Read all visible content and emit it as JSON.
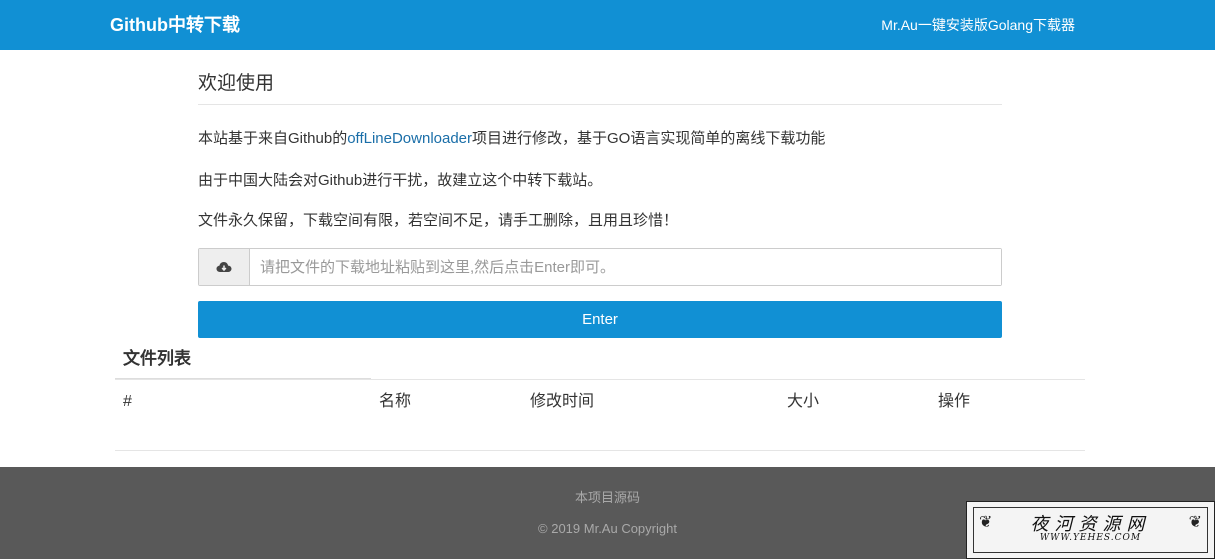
{
  "navbar": {
    "brand": "Github中转下载",
    "link": "Mr.Au一键安装版Golang下载器",
    "color": "#1190d4"
  },
  "main": {
    "welcome_title": "欢迎使用",
    "intro": {
      "line1_prefix": "本站基于来自Github的",
      "line1_link": "offLineDownloader",
      "line1_suffix": "项目进行修改，基于GO语言实现简单的离线下载功能",
      "line2": "由于中国大陆会对Github进行干扰，故建立这个中转下载站。",
      "line3": "文件永久保留，下载空间有限，若空间不足，请手工删除，且用且珍惜！"
    },
    "url_input": {
      "icon": "cloud-download-icon",
      "value": "",
      "placeholder": "请把文件的下载地址粘贴到这里,然后点击Enter即可。"
    },
    "enter_label": "Enter"
  },
  "files": {
    "title": "文件列表",
    "columns": [
      "#",
      "名称",
      "修改时间",
      "大小",
      "操作"
    ],
    "rows": []
  },
  "footer": {
    "source_link": "本项目源码",
    "copyright": "© 2019 Mr.Au Copyright"
  },
  "watermark": {
    "cn": "夜河资源网",
    "en": "WWW.YEHES.COM"
  }
}
